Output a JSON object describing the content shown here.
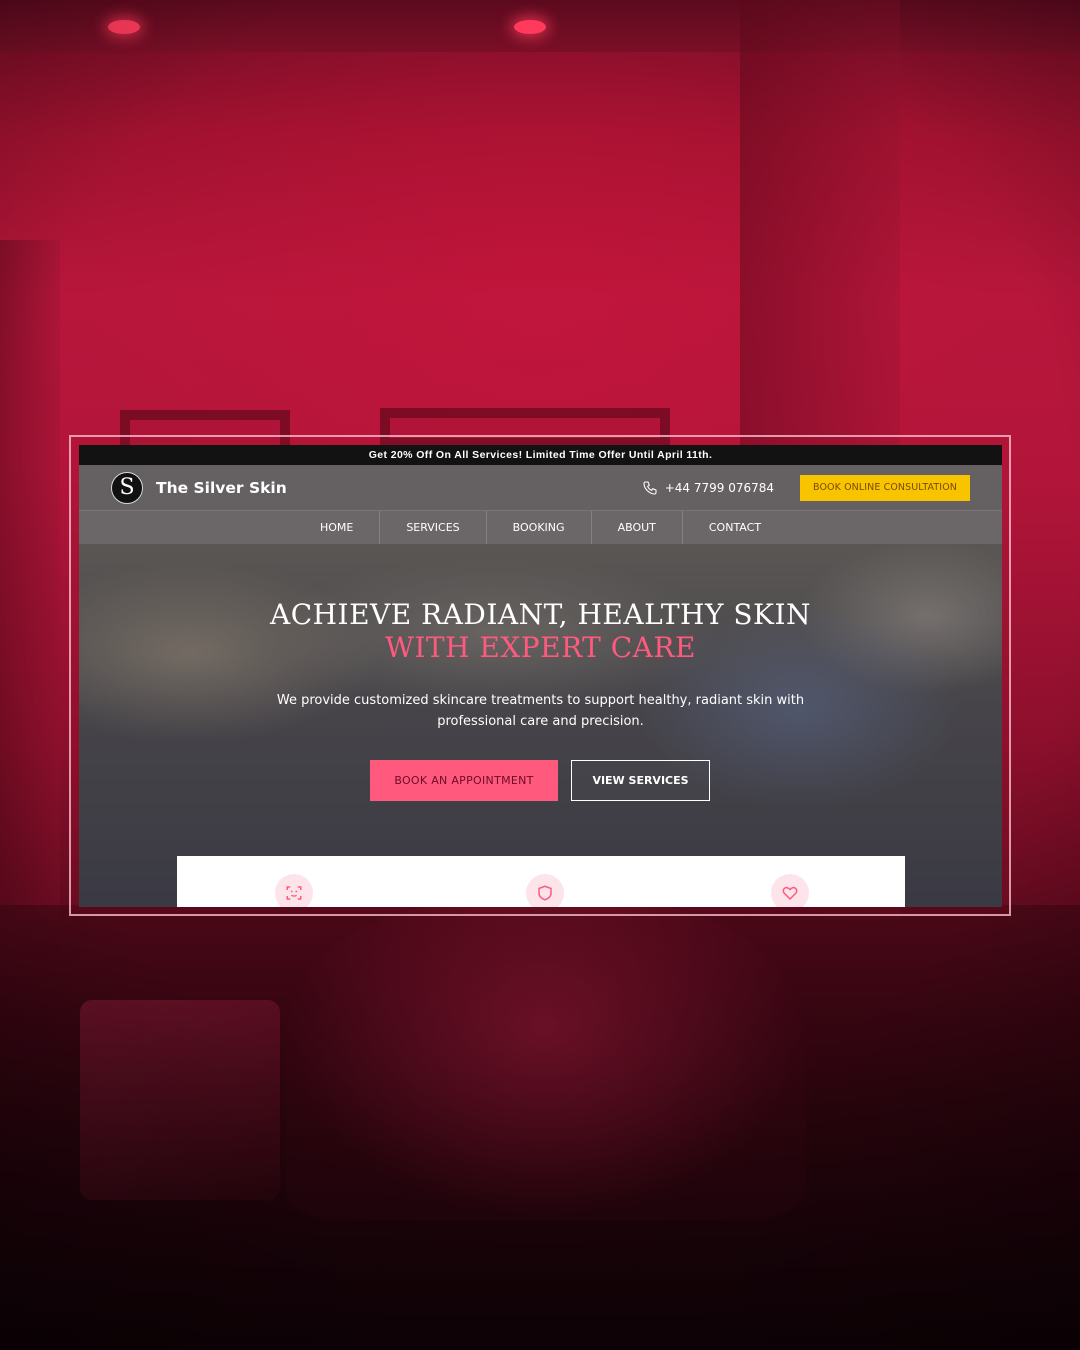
{
  "promo": {
    "text": "Get 20% Off On All Services! Limited Time Offer Until April 11th."
  },
  "header": {
    "logo_letter": "S",
    "brand": "The Silver Skin",
    "phone": "+44 7799 076784",
    "consult_label": "BOOK ONLINE CONSULTATION"
  },
  "nav": {
    "items": [
      {
        "label": "HOME"
      },
      {
        "label": "SERVICES"
      },
      {
        "label": "BOOKING"
      },
      {
        "label": "ABOUT"
      },
      {
        "label": "CONTACT"
      }
    ]
  },
  "hero": {
    "title_line1": "ACHIEVE RADIANT, HEALTHY SKIN",
    "title_line2": "WITH EXPERT CARE",
    "description": "We provide customized skincare treatments to support healthy, radiant skin with professional care and precision.",
    "primary_button": "BOOK AN APPOINTMENT",
    "secondary_button": "VIEW SERVICES"
  },
  "features": {
    "icons": [
      "face-scan-icon",
      "shield-icon",
      "heart-icon"
    ]
  },
  "colors": {
    "accent_pink": "#ff5a7e",
    "consult_yellow": "#f8c400",
    "backdrop_red": "#b8163b",
    "promo_bar": "#121212"
  }
}
